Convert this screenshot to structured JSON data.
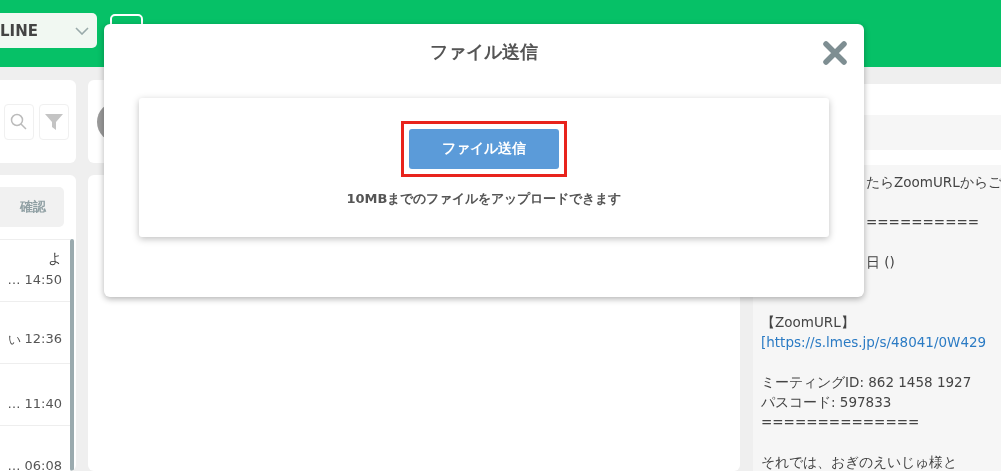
{
  "header": {
    "account_select": {
      "value": "LINE"
    }
  },
  "sidebar": {
    "confirm_button": "確認",
    "conversations": [
      {
        "title": "よ",
        "preview": "…",
        "time": "14:50"
      },
      {
        "preview": "い",
        "time": "12:36"
      },
      {
        "preview": "…",
        "time": "11:40"
      },
      {
        "preview": "…",
        "time": "06:08"
      }
    ]
  },
  "chat": {
    "lines": [
      {
        "kind": "partial",
        "text": "たらZoomURLからご"
      },
      {
        "kind": "gap"
      },
      {
        "kind": "partial",
        "text": "=========="
      },
      {
        "kind": "gap"
      },
      {
        "kind": "partial",
        "text": "日 ()"
      },
      {
        "kind": "gap"
      },
      {
        "kind": "gap"
      },
      {
        "kind": "text",
        "text": "【ZoomURL】"
      },
      {
        "kind": "link",
        "text": "[https://s.lmes.jp/s/48041/0W429"
      },
      {
        "kind": "gap"
      },
      {
        "kind": "text",
        "text": "ミーティングID: 862 1458 1927"
      },
      {
        "kind": "text",
        "text": "パスコード: 597833"
      },
      {
        "kind": "text",
        "text": "=============="
      },
      {
        "kind": "gap"
      },
      {
        "kind": "text",
        "text": "それでは、おぎのえいじゅ様と"
      }
    ]
  },
  "modal": {
    "title": "ファイル送信",
    "upload_button": "ファイル送信",
    "upload_button_highlighted": true,
    "note": "10MBまでのファイルをアップロードできます"
  }
}
